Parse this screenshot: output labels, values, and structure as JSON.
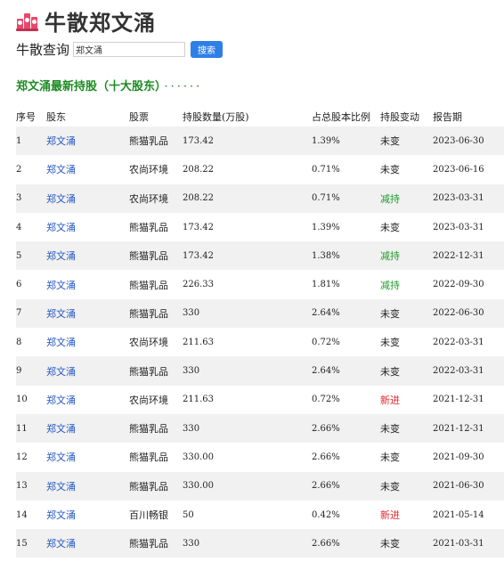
{
  "site": {
    "title": "牛散郑文涌"
  },
  "search": {
    "label": "牛散查询",
    "value": "郑文涌",
    "button": "搜索"
  },
  "section": {
    "title": "郑文涌最新持股（十大股东）",
    "dots": "······"
  },
  "table": {
    "headers": [
      "序号",
      "股东",
      "股票",
      "持股数量(万股)",
      "占总股本比例",
      "持股变动",
      "报告期"
    ],
    "rows": [
      {
        "no": "1",
        "holder": "郑文涌",
        "stock": "熊猫乳品",
        "qty": "173.42",
        "ratio": "1.39%",
        "change": "未变",
        "period": "2023-06-30"
      },
      {
        "no": "2",
        "holder": "郑文涌",
        "stock": "农尚环境",
        "qty": "208.22",
        "ratio": "0.71%",
        "change": "未变",
        "period": "2023-06-16"
      },
      {
        "no": "3",
        "holder": "郑文涌",
        "stock": "农尚环境",
        "qty": "208.22",
        "ratio": "0.71%",
        "change": "减持",
        "period": "2023-03-31"
      },
      {
        "no": "4",
        "holder": "郑文涌",
        "stock": "熊猫乳品",
        "qty": "173.42",
        "ratio": "1.39%",
        "change": "未变",
        "period": "2023-03-31"
      },
      {
        "no": "5",
        "holder": "郑文涌",
        "stock": "熊猫乳品",
        "qty": "173.42",
        "ratio": "1.38%",
        "change": "减持",
        "period": "2022-12-31"
      },
      {
        "no": "6",
        "holder": "郑文涌",
        "stock": "熊猫乳品",
        "qty": "226.33",
        "ratio": "1.81%",
        "change": "减持",
        "period": "2022-09-30"
      },
      {
        "no": "7",
        "holder": "郑文涌",
        "stock": "熊猫乳品",
        "qty": "330",
        "ratio": "2.64%",
        "change": "未变",
        "period": "2022-06-30"
      },
      {
        "no": "8",
        "holder": "郑文涌",
        "stock": "农尚环境",
        "qty": "211.63",
        "ratio": "0.72%",
        "change": "未变",
        "period": "2022-03-31"
      },
      {
        "no": "9",
        "holder": "郑文涌",
        "stock": "熊猫乳品",
        "qty": "330",
        "ratio": "2.64%",
        "change": "未变",
        "period": "2022-03-31"
      },
      {
        "no": "10",
        "holder": "郑文涌",
        "stock": "农尚环境",
        "qty": "211.63",
        "ratio": "0.72%",
        "change": "新进",
        "period": "2021-12-31"
      },
      {
        "no": "11",
        "holder": "郑文涌",
        "stock": "熊猫乳品",
        "qty": "330",
        "ratio": "2.66%",
        "change": "未变",
        "period": "2021-12-31"
      },
      {
        "no": "12",
        "holder": "郑文涌",
        "stock": "熊猫乳品",
        "qty": "330.00",
        "ratio": "2.66%",
        "change": "未变",
        "period": "2021-09-30"
      },
      {
        "no": "13",
        "holder": "郑文涌",
        "stock": "熊猫乳品",
        "qty": "330.00",
        "ratio": "2.66%",
        "change": "未变",
        "period": "2021-06-30"
      },
      {
        "no": "14",
        "holder": "郑文涌",
        "stock": "百川畅银",
        "qty": "50",
        "ratio": "0.42%",
        "change": "新进",
        "period": "2021-05-14"
      },
      {
        "no": "15",
        "holder": "郑文涌",
        "stock": "熊猫乳品",
        "qty": "330",
        "ratio": "2.66%",
        "change": "未变",
        "period": "2021-03-31"
      }
    ]
  },
  "colors": {
    "brand": "#e8486a",
    "link": "#2457c5",
    "section_green": "#1d8a24",
    "reduce": "#1f9a2a",
    "new": "#e0262c",
    "button": "#2f7fe8"
  },
  "icons": {
    "logo": "stock-books-logo-icon"
  }
}
